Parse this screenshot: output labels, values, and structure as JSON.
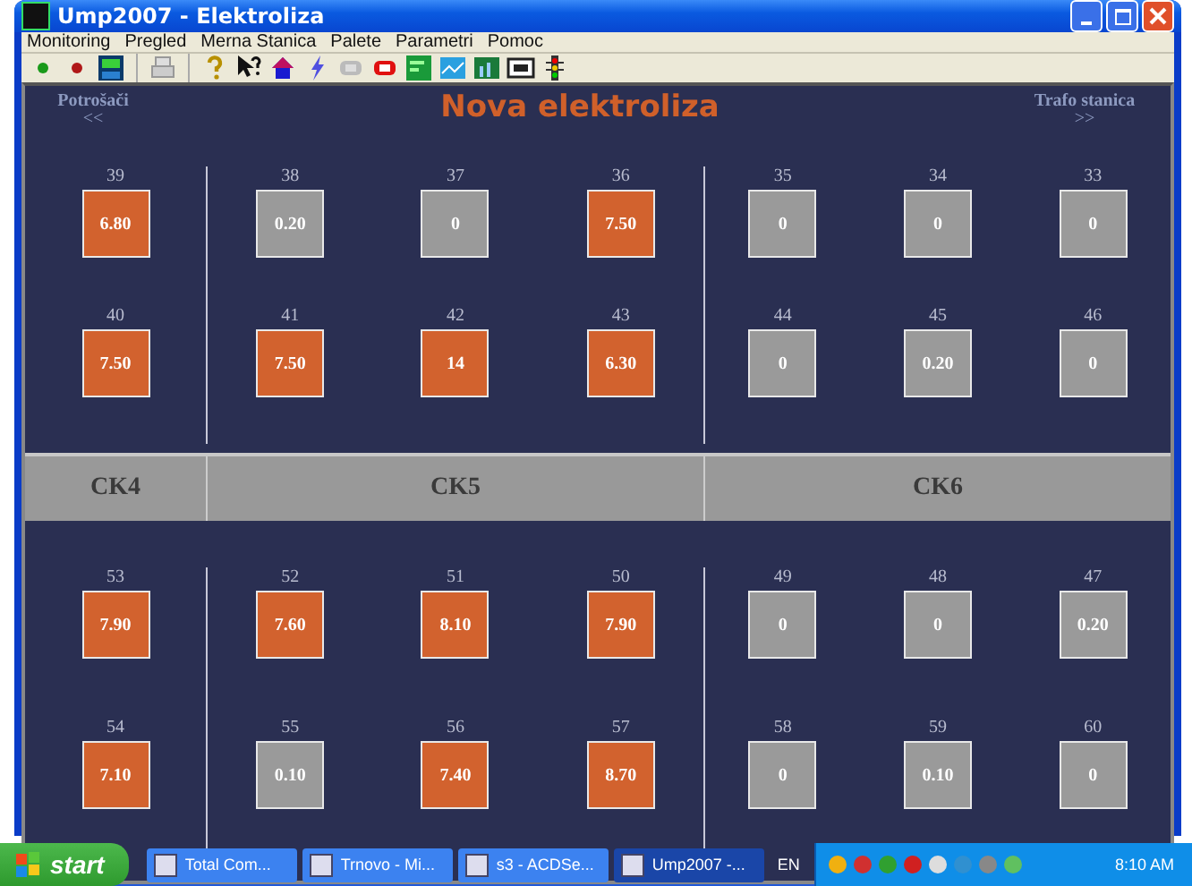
{
  "window": {
    "title": "Ump2007 - Elektroliza"
  },
  "menu": [
    "Monitoring",
    "Pregled",
    "Merna Stanica",
    "Palete",
    "Parametri",
    "Pomoc"
  ],
  "panel": {
    "left_label": "Potrošači",
    "left_arrow": "<<",
    "title": "Nova elektroliza",
    "right_label": "Trafo stanica",
    "right_arrow": ">>",
    "upper": [
      {
        "tiles": [
          {
            "number": "39",
            "value": "6.80",
            "on": true
          },
          {
            "number": "40",
            "value": "7.50",
            "on": true
          }
        ]
      },
      {
        "tiles": [
          {
            "number": "38",
            "value": "0.20",
            "on": false
          },
          {
            "number": "37",
            "value": "0",
            "on": false
          },
          {
            "number": "36",
            "value": "7.50",
            "on": true
          },
          {
            "number": "41",
            "value": "7.50",
            "on": true
          },
          {
            "number": "42",
            "value": "14",
            "on": true
          },
          {
            "number": "43",
            "value": "6.30",
            "on": true
          }
        ]
      },
      {
        "tiles": [
          {
            "number": "35",
            "value": "0",
            "on": false
          },
          {
            "number": "34",
            "value": "0",
            "on": false
          },
          {
            "number": "33",
            "value": "0",
            "on": false
          },
          {
            "number": "44",
            "value": "0",
            "on": false
          },
          {
            "number": "45",
            "value": "0.20",
            "on": false
          },
          {
            "number": "46",
            "value": "0",
            "on": false
          }
        ]
      }
    ],
    "bands": [
      "CK4",
      "CK5",
      "CK6"
    ],
    "lower": [
      {
        "tiles": [
          {
            "number": "53",
            "value": "7.90",
            "on": true
          },
          {
            "number": "54",
            "value": "7.10",
            "on": true
          }
        ]
      },
      {
        "tiles": [
          {
            "number": "52",
            "value": "7.60",
            "on": true
          },
          {
            "number": "51",
            "value": "8.10",
            "on": true
          },
          {
            "number": "50",
            "value": "7.90",
            "on": true
          },
          {
            "number": "55",
            "value": "0.10",
            "on": false
          },
          {
            "number": "56",
            "value": "7.40",
            "on": true
          },
          {
            "number": "57",
            "value": "8.70",
            "on": true
          }
        ]
      },
      {
        "tiles": [
          {
            "number": "49",
            "value": "0",
            "on": false
          },
          {
            "number": "48",
            "value": "0",
            "on": false
          },
          {
            "number": "47",
            "value": "0.20",
            "on": false
          },
          {
            "number": "58",
            "value": "0",
            "on": false
          },
          {
            "number": "59",
            "value": "0.10",
            "on": false
          },
          {
            "number": "60",
            "value": "0",
            "on": false
          }
        ]
      }
    ]
  },
  "taskbar": {
    "start": "start",
    "tasks": [
      {
        "label": "Total Com...",
        "selected": false
      },
      {
        "label": "Trnovo - Mi...",
        "selected": false
      },
      {
        "label": "s3 - ACDSe...",
        "selected": false
      },
      {
        "label": "Ump2007 -...",
        "selected": true
      }
    ],
    "language": "EN",
    "clock": "8:10 AM"
  }
}
